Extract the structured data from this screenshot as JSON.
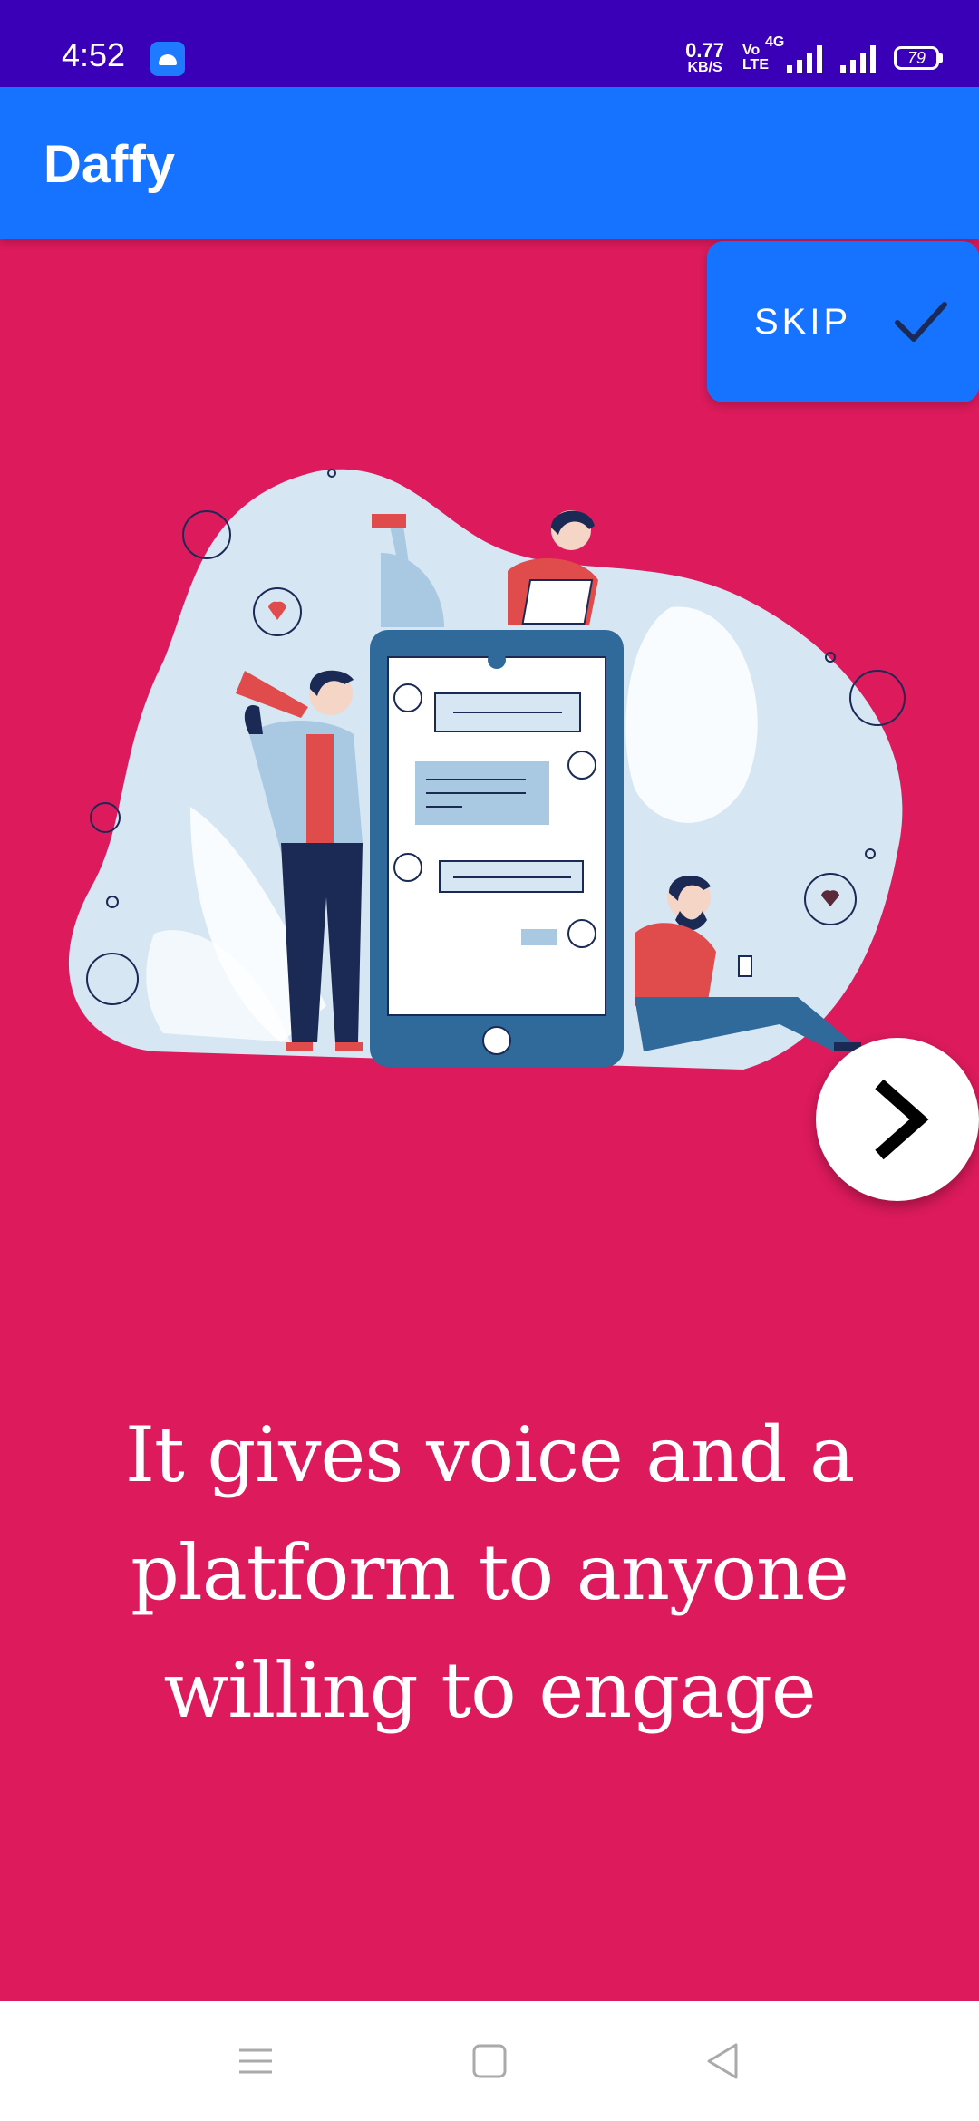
{
  "status_bar": {
    "time": "4:52",
    "net_speed_value": "0.77",
    "net_speed_unit": "KB/S",
    "volte_top": "Vo",
    "volte_bottom": "LTE",
    "network_type": "4G",
    "battery_level": "79"
  },
  "app_bar": {
    "title": "Daffy"
  },
  "onboarding": {
    "skip_label": "SKIP",
    "caption": "It gives voice and a platform to anyone willing to engage",
    "next_icon": "chevron-right-icon"
  },
  "colors": {
    "status_bar": "#3a00b8",
    "app_bar": "#1673ff",
    "background": "#dc1a5c",
    "skip_button": "#1673ff"
  },
  "nav_bar": {
    "icons": [
      "menu-icon",
      "home-square-icon",
      "back-triangle-icon"
    ]
  }
}
